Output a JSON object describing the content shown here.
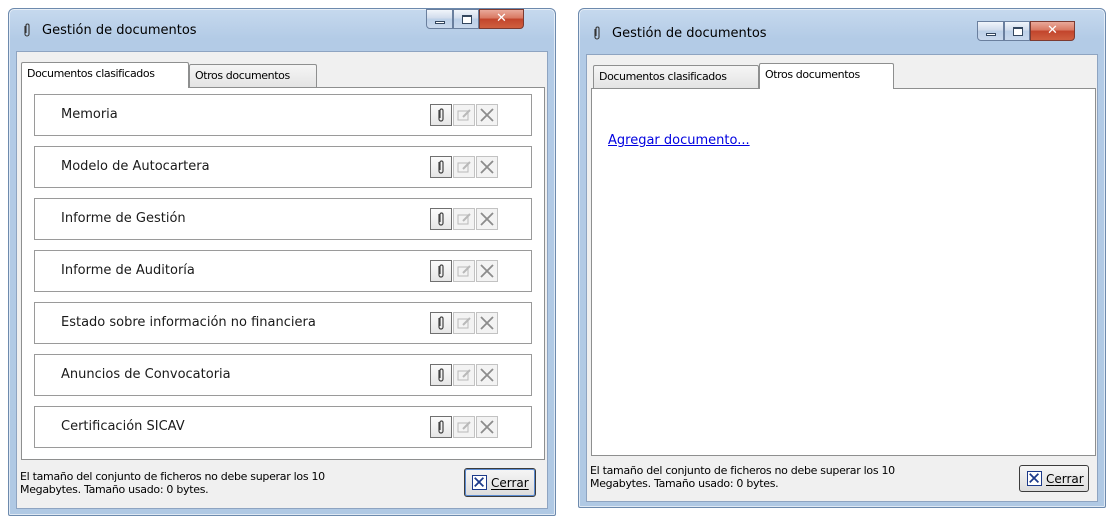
{
  "window": {
    "title": "Gestión de documentos"
  },
  "tabs": [
    {
      "label": "Documentos clasificados"
    },
    {
      "label": "Otros documentos"
    }
  ],
  "documents": [
    {
      "label": "Memoria"
    },
    {
      "label": "Modelo de Autocartera"
    },
    {
      "label": "Informe de Gestión"
    },
    {
      "label": "Informe de Auditoría"
    },
    {
      "label": "Estado sobre información no financiera"
    },
    {
      "label": "Anuncios de Convocatoria"
    },
    {
      "label": "Certificación SICAV"
    }
  ],
  "other_documents": {
    "add_link": "Agregar documento..."
  },
  "footer": {
    "line1": "El tamaño del conjunto de ficheros no debe superar los 10",
    "line2": "Megabytes. Tamaño usado: 0 bytes.",
    "close_mnemonic": "C",
    "close_rest": "errar"
  },
  "icons": {
    "title": "paperclip-icon",
    "attach": "paperclip-icon",
    "edit": "edit-icon",
    "delete": "delete-x-icon",
    "close": "close-x-icon"
  },
  "colors": {
    "link": "#0000e0",
    "title_bar": "#b3cbe6",
    "close_caption": "#c2452c"
  }
}
